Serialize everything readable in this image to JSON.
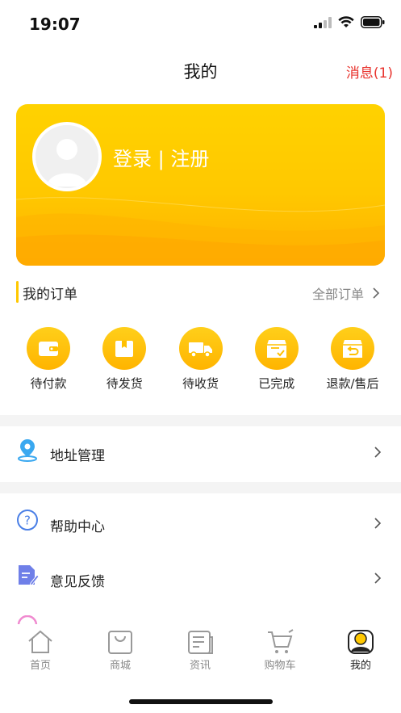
{
  "status_bar": {
    "time": "19:07"
  },
  "nav": {
    "title": "我的",
    "messages": "消息(1)"
  },
  "profile": {
    "login_text": "登录 | 注册"
  },
  "orders": {
    "title": "我的订单",
    "all_orders": "全部订单",
    "items": [
      {
        "label": "待付款",
        "icon": "wallet-icon"
      },
      {
        "label": "待发货",
        "icon": "package-icon"
      },
      {
        "label": "待收货",
        "icon": "truck-icon"
      },
      {
        "label": "已完成",
        "icon": "completed-box-icon"
      },
      {
        "label": "退款/售后",
        "icon": "return-box-icon"
      }
    ]
  },
  "menu": {
    "address": "地址管理",
    "help": "帮助中心",
    "feedback": "意见反馈"
  },
  "tabs": [
    {
      "label": "首页",
      "icon": "home-icon"
    },
    {
      "label": "商城",
      "icon": "shopping-bag-icon"
    },
    {
      "label": "资讯",
      "icon": "news-icon"
    },
    {
      "label": "购物车",
      "icon": "cart-icon"
    },
    {
      "label": "我的",
      "icon": "profile-icon",
      "active": true
    }
  ],
  "colors": {
    "accent": "#ffc800",
    "message_red": "#e8332d",
    "help_blue": "#4a7fe6",
    "location_blue": "#3aa8f0",
    "feedback_purple": "#6f7fe8"
  }
}
